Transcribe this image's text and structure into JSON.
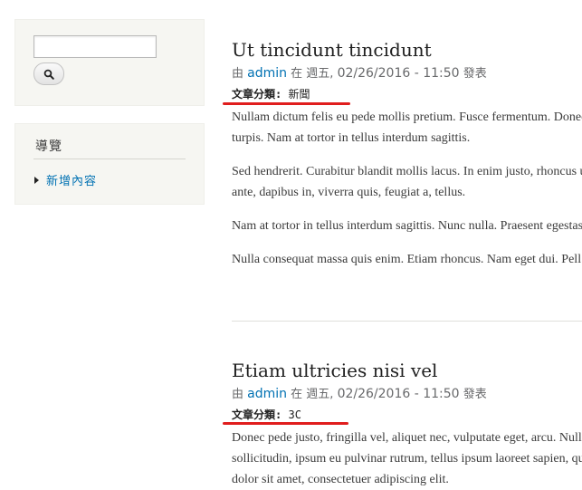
{
  "search": {
    "value": "",
    "placeholder": "",
    "button_icon": "search-icon"
  },
  "navigation": {
    "title": "導覽",
    "items": [
      {
        "label": "新增內容"
      }
    ]
  },
  "articles": [
    {
      "title": "Ut tincidunt tincidunt",
      "meta_prefix": "由",
      "author": "admin",
      "meta_middle": "在 週五,",
      "date": "02/26/2016 - 11:50",
      "meta_suffix": "發表",
      "category_label": "文章分類:",
      "category_value": "新聞",
      "paragraphs": [
        [
          "Nullam dictum felis eu pede mollis pretium. Fusce fermentum. Donec",
          "turpis. Nam at tortor in tellus interdum sagittis."
        ],
        [
          "Sed hendrerit. Curabitur blandit mollis lacus. In enim justo, rhoncus u",
          "ante, dapibus in, viverra quis, feugiat a, tellus."
        ],
        [
          "Nam at tortor in tellus interdum sagittis. Nunc nulla. Praesent egestas"
        ],
        [
          "Nulla consequat massa quis enim. Etiam rhoncus. Nam eget dui. Pell"
        ]
      ]
    },
    {
      "title": "Etiam ultricies nisi vel",
      "meta_prefix": "由",
      "author": "admin",
      "meta_middle": "在 週五,",
      "date": "02/26/2016 - 11:50",
      "meta_suffix": "發表",
      "category_label": "文章分類:",
      "category_value": "3C",
      "paragraphs": [
        [
          "Donec pede justo, fringilla vel, aliquet nec, vulputate eget, arcu. Null",
          "sollicitudin, ipsum eu pulvinar rutrum, tellus ipsum laoreet sapien, qu",
          "dolor sit amet, consectetuer adipiscing elit."
        ]
      ]
    }
  ],
  "colors": {
    "link": "#0071b3",
    "annotation_underline": "#e01d1d",
    "sidebar_bg": "#f6f6f2"
  }
}
